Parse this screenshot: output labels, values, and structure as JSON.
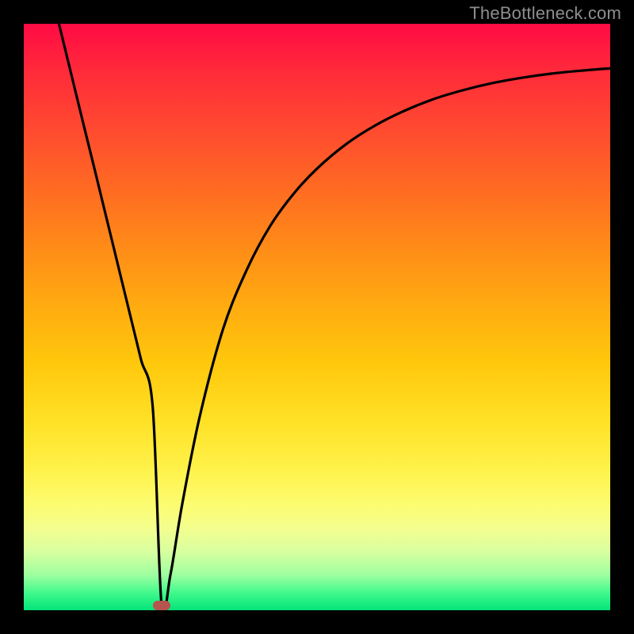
{
  "watermark": "TheBottleneck.com",
  "chart_data": {
    "type": "line",
    "title": "",
    "xlabel": "",
    "ylabel": "",
    "xlim": [
      0,
      100
    ],
    "ylim": [
      0,
      100
    ],
    "grid": false,
    "legend": false,
    "series": [
      {
        "name": "bottleneck-curve",
        "x": [
          6,
          8,
          10,
          12,
          14,
          16,
          18,
          20,
          22,
          23.5,
          25,
          27,
          30,
          34,
          38,
          42,
          46,
          50,
          55,
          60,
          65,
          70,
          75,
          80,
          85,
          90,
          95,
          100
        ],
        "y": [
          100,
          91.8,
          83.6,
          75.5,
          67.3,
          59.1,
          50.9,
          42.7,
          34.5,
          0.8,
          6,
          18,
          33,
          48,
          58,
          65.5,
          71,
          75.3,
          79.5,
          82.7,
          85.2,
          87.2,
          88.7,
          89.9,
          90.8,
          91.5,
          92,
          92.4
        ]
      }
    ],
    "marker": {
      "x": 23.5,
      "y": 0.8,
      "shape": "pill",
      "color": "#b6544e"
    },
    "background_gradient": {
      "direction": "vertical",
      "stops": [
        {
          "pos": 0.0,
          "color": "#ff0a44"
        },
        {
          "pos": 0.5,
          "color": "#ffc80c"
        },
        {
          "pos": 0.82,
          "color": "#fcfc70"
        },
        {
          "pos": 1.0,
          "color": "#02e47a"
        }
      ]
    }
  }
}
